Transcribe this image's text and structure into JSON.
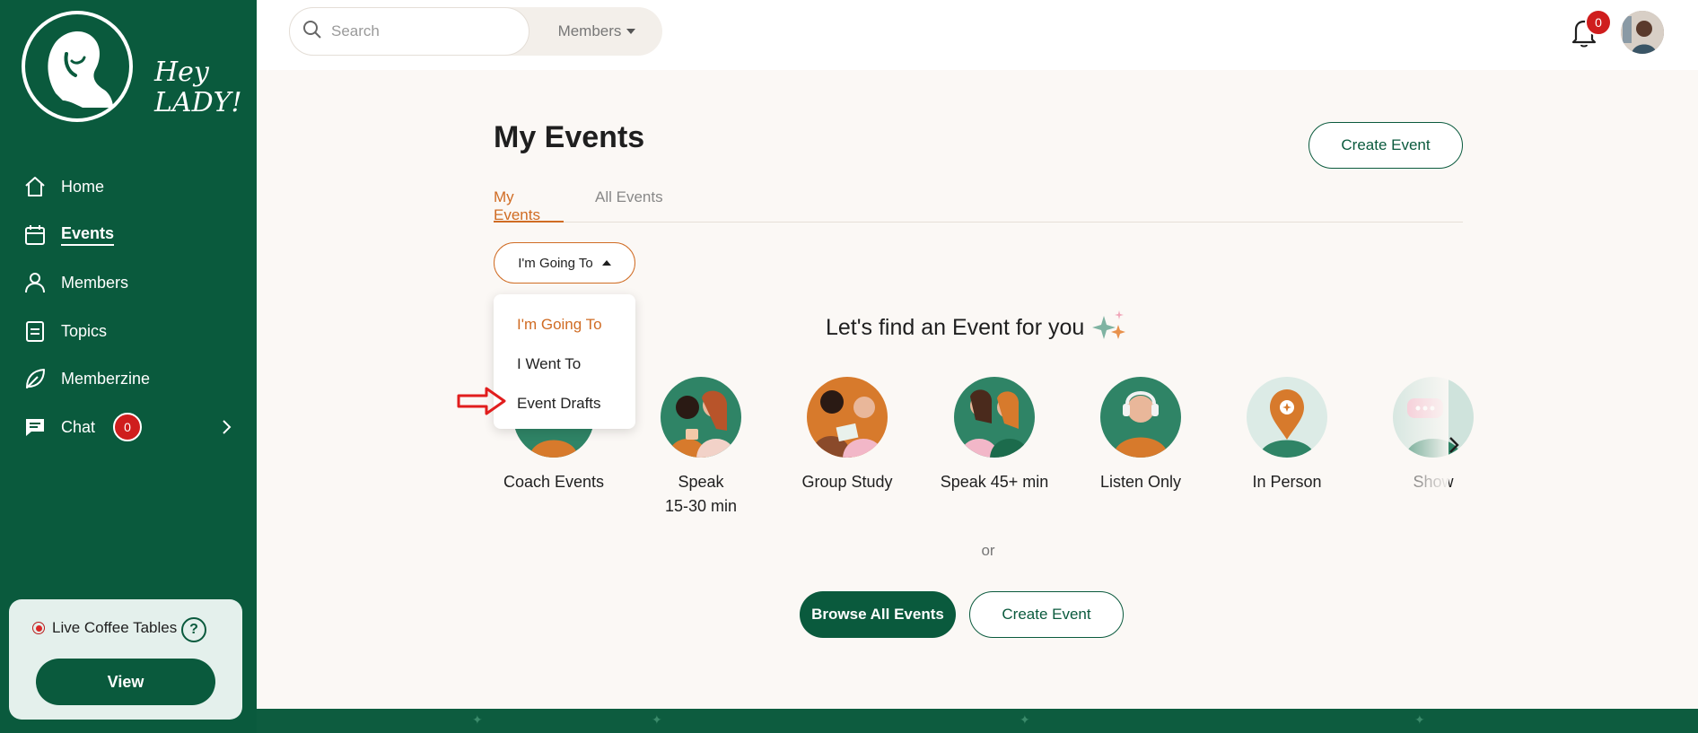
{
  "app": {
    "logo_text_line1": "Hey",
    "logo_text_line2": "LADY!"
  },
  "sidebar": {
    "items": [
      {
        "label": "Home",
        "icon": "home-icon"
      },
      {
        "label": "Events",
        "icon": "calendar-icon",
        "active": true
      },
      {
        "label": "Members",
        "icon": "user-icon"
      },
      {
        "label": "Topics",
        "icon": "document-icon"
      },
      {
        "label": "Memberzine",
        "icon": "leaf-icon"
      },
      {
        "label": "Chat",
        "icon": "chat-icon",
        "badge": "0"
      }
    ],
    "coffee": {
      "title": "Live Coffee Tables",
      "help": "?",
      "view_label": "View"
    }
  },
  "header": {
    "search_placeholder": "Search",
    "scope_label": "Members",
    "notifications_count": "0"
  },
  "main": {
    "title": "My Events",
    "create_label": "Create Event",
    "tabs": [
      {
        "label": "My Events",
        "active": true
      },
      {
        "label": "All Events",
        "active": false
      }
    ],
    "filter_label": "I'm Going To",
    "dropdown_options": [
      "I'm Going To",
      "I Went To",
      "Event Drafts"
    ],
    "find_title": "Let's find an Event for you",
    "categories": [
      {
        "label": "Coach Events"
      },
      {
        "label": "Speak",
        "sub": "15-30 min"
      },
      {
        "label": "Group Study"
      },
      {
        "label": "Speak 45+ min"
      },
      {
        "label": "Listen Only"
      },
      {
        "label": "In Person"
      },
      {
        "label": "Show"
      }
    ],
    "or_label": "or",
    "browse_label": "Browse All Events",
    "create_bottom_label": "Create Event"
  },
  "colors": {
    "brand_green": "#0a5a3d",
    "accent_orange": "#d06c24",
    "badge_red": "#cf1d1d",
    "page_bg": "#fbf8f5"
  }
}
